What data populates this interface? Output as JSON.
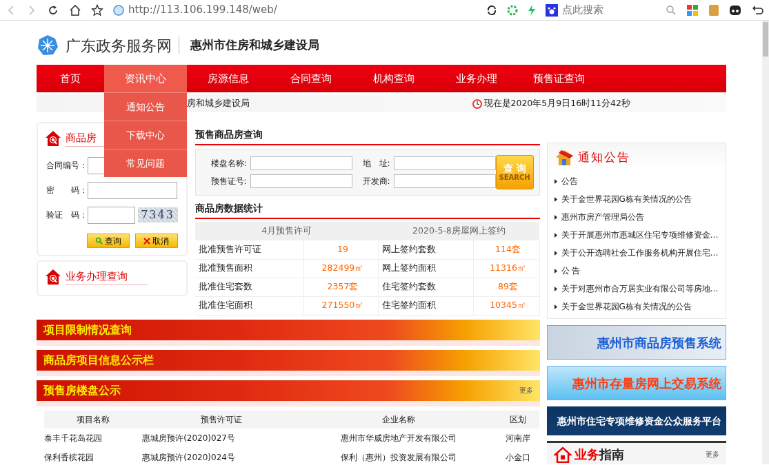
{
  "browser": {
    "url": "http://113.106.199.148/web/",
    "search_placeholder": "点此搜索"
  },
  "site": {
    "portal": "广东政务服务网",
    "bureau": "惠州市住房和城乡建设局"
  },
  "nav": [
    {
      "label": "首页",
      "selected": false
    },
    {
      "label": "资讯中心",
      "selected": true
    },
    {
      "label": "房源信息",
      "selected": false
    },
    {
      "label": "合同查询",
      "selected": false
    },
    {
      "label": "机构查询",
      "selected": false
    },
    {
      "label": "业务办理",
      "selected": false
    },
    {
      "label": "预售证查询",
      "selected": false
    }
  ],
  "dropdown": [
    "通知公告",
    "下载中心",
    "常见问题"
  ],
  "ticker": {
    "text": "房和城乡建设局",
    "clock": "现在是2020年5月9日16时11分42秒"
  },
  "login": {
    "title": "商品房",
    "fields": [
      {
        "label": "合同编号：",
        "kind": "text"
      },
      {
        "label": "密　　码：",
        "kind": "password"
      },
      {
        "label": "验证　码：",
        "kind": "captcha",
        "captcha": "7343"
      }
    ],
    "buttons": [
      {
        "label": "查询",
        "kind": "search"
      },
      {
        "label": "取消",
        "kind": "cancel"
      }
    ]
  },
  "business_query": {
    "title": "业务办理查询"
  },
  "presale_search": {
    "title": "预售商品房查询",
    "fields": [
      {
        "label": "楼盘名称:"
      },
      {
        "label": "地　址:"
      },
      {
        "label": "预售证号:"
      },
      {
        "label": "开发商:"
      }
    ],
    "button": {
      "label": "查 询",
      "sublabel": "SEARCH"
    }
  },
  "stats": {
    "title": "商品房数据统计",
    "headers": [
      "4月预售许可",
      "2020-5-8房屋网上签约"
    ],
    "rows": [
      [
        "批准预售许可证",
        "19",
        "网上签约套数",
        "114套"
      ],
      [
        "批准预售面积",
        "282499㎡",
        "网上签约面积",
        "11316㎡"
      ],
      [
        "批准住宅套数",
        "2357套",
        "住宅签约套数",
        "89套"
      ],
      [
        "批准住宅面积",
        "271550㎡",
        "住宅签约面积",
        "10345㎡"
      ]
    ]
  },
  "sections": [
    {
      "title": "项目限制情况查询"
    },
    {
      "title": "商品房项目信息公示栏"
    },
    {
      "title": "预售房楼盘公示",
      "more": "更多"
    }
  ],
  "listing": {
    "columns": [
      "项目名称",
      "预售许可证",
      "企业名称",
      "区划"
    ],
    "rows": [
      [
        "泰丰千花岛花园",
        "惠城房预许(2020)027号",
        "惠州市华威房地产开发有限公司",
        "河南岸"
      ],
      [
        "保利香槟花园",
        "惠城房预许(2020)024号",
        "保利（惠州）投资发展有限公司",
        "小金口"
      ]
    ]
  },
  "notices": {
    "title": "通知公告",
    "items": [
      "公告",
      "关于金世界花园G栋有关情况的公告",
      "惠州市房产管理局公告",
      "关于开展惠州市惠城区住宅专项维修资金…",
      "关于公开选聘社会工作服务机构开展住宅…",
      "公 告",
      "关于对惠州市合万居实业有限公司等房地…",
      "关于金世界花园G栋有关情况的公告"
    ]
  },
  "promo_banners": [
    {
      "title": "惠州市商品房预售系统",
      "kind": "presale"
    },
    {
      "title": "惠州市存量房网上交易系统",
      "kind": "resale"
    },
    {
      "title": "惠州市住宅专项维修资金公众服务平台",
      "kind": "fund"
    }
  ],
  "guide": {
    "title": "业务",
    "title_rest": "指南",
    "more": "更多"
  }
}
